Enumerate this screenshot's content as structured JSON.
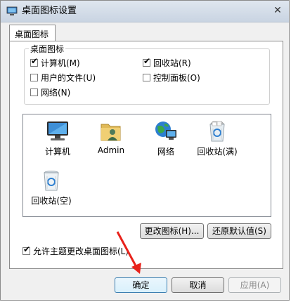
{
  "window": {
    "title": "桌面图标设置",
    "close_glyph": "✕"
  },
  "tabs": [
    {
      "label": "桌面图标"
    }
  ],
  "group": {
    "legend": "桌面图标",
    "checkboxes": [
      {
        "label": "计算机(M)",
        "checked": true
      },
      {
        "label": "回收站(R)",
        "checked": true
      },
      {
        "label": "用户的文件(U)",
        "checked": false
      },
      {
        "label": "控制面板(O)",
        "checked": false
      },
      {
        "label": "网络(N)",
        "checked": false
      }
    ]
  },
  "icons": [
    {
      "label": "计算机",
      "icon": "computer-icon"
    },
    {
      "label": "Admin",
      "icon": "user-folder-icon"
    },
    {
      "label": "网络",
      "icon": "network-icon"
    },
    {
      "label": "回收站(满)",
      "icon": "recycle-bin-full-icon"
    },
    {
      "label": "回收站(空)",
      "icon": "recycle-bin-empty-icon"
    }
  ],
  "buttons": {
    "change_icon": "更改图标(H)...",
    "restore_default": "还原默认值(S)",
    "ok": "确定",
    "cancel": "取消",
    "apply": "应用(A)"
  },
  "allow_theme": {
    "label": "允许主题更改桌面图标(L)",
    "checked": true
  },
  "colors": {
    "title_bg": "#c9d4e2",
    "accent": "#3c7fb1",
    "arrow": "#e8221b"
  }
}
